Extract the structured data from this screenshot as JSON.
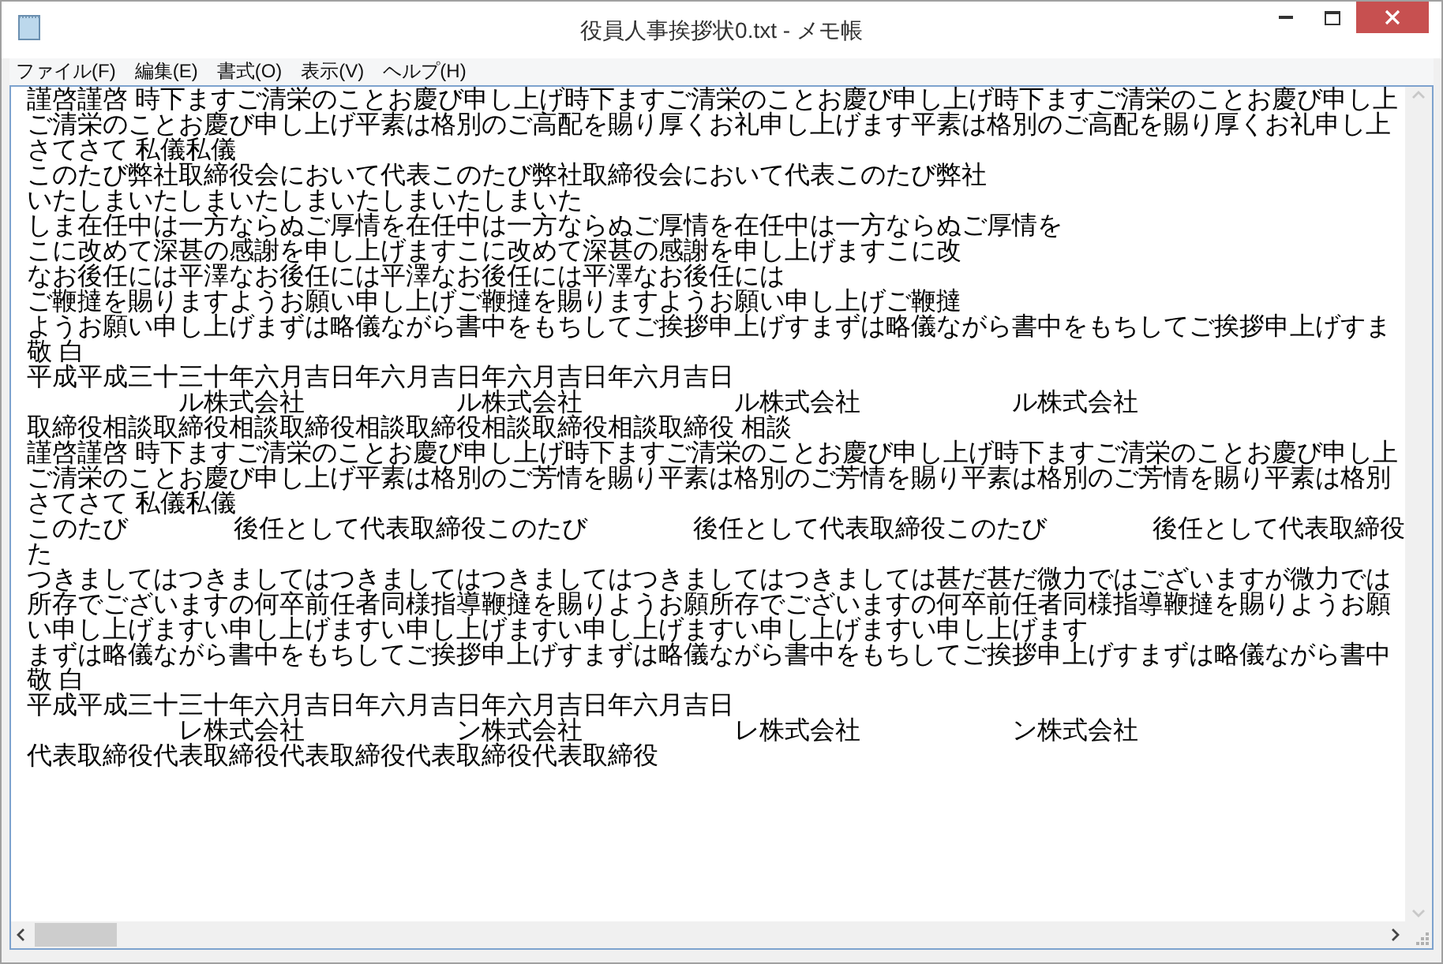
{
  "window": {
    "title": "役員人事挨拶状0.txt - メモ帳"
  },
  "menu": [
    "ファイル(F)",
    "編集(E)",
    "書式(O)",
    "表示(V)",
    "ヘルプ(H)"
  ],
  "lines": [
    {
      "segments": [
        {
          "kind": "text",
          "text": "謹啓謹啓 時下ますご清栄のことお慶び申し上げ時下ますご清栄のことお慶び申し上げ時下ますご清栄のことお慶び申し上"
        }
      ]
    },
    {
      "segments": [
        {
          "kind": "text",
          "text": "ご清栄のことお慶び申し上げ平素は格別のご高配を賜り厚くお礼申し上げます平素は格別のご高配を賜り厚くお礼申し上"
        }
      ]
    },
    {
      "segments": [
        {
          "kind": "text",
          "text": "さてさて 私儀私儀"
        }
      ]
    },
    {
      "segments": [
        {
          "kind": "text",
          "text": "このたび弊社取締役会において代表このたび弊社取締役会において代表このたび弊社"
        }
      ]
    },
    {
      "segments": [
        {
          "kind": "text",
          "text": "いたしまいたしまいたしまいたしまいたしまいた"
        }
      ]
    },
    {
      "segments": [
        {
          "kind": "text",
          "text": "しま在任中は一方ならぬご厚情を在任中は一方ならぬご厚情を在任中は一方ならぬご厚情を"
        }
      ]
    },
    {
      "segments": [
        {
          "kind": "text",
          "text": "こに改めて深甚の感謝を申し上げますこに改めて深甚の感謝を申し上げますこに改"
        }
      ]
    },
    {
      "segments": [
        {
          "kind": "text",
          "text": "なお後任には平澤なお後任には平澤なお後任には平澤なお後任には"
        }
      ]
    },
    {
      "segments": [
        {
          "kind": "text",
          "text": "ご鞭撻を賜りますようお願い申し上げご鞭撻を賜りますようお願い申し上げご鞭撻"
        }
      ]
    },
    {
      "segments": [
        {
          "kind": "text",
          "text": "ようお願い申し上げまずは略儀ながら書中をもちしてご挨拶申上げすまずは略儀ながら書中をもちしてご挨拶申上げすま"
        }
      ]
    },
    {
      "segments": [
        {
          "kind": "text",
          "text": "敬 白"
        }
      ]
    },
    {
      "segments": [
        {
          "kind": "text",
          "text": "平成平成三十三十年六月吉日年六月吉日年六月吉日年六月吉日"
        }
      ]
    },
    {
      "segments": [
        {
          "kind": "redacted"
        },
        {
          "kind": "text",
          "text": "ル株式会社"
        },
        {
          "kind": "redacted"
        },
        {
          "kind": "text",
          "text": "ル株式会社"
        },
        {
          "kind": "redacted"
        },
        {
          "kind": "text",
          "text": "ル株式会社"
        },
        {
          "kind": "redacted"
        },
        {
          "kind": "text",
          "text": "ル株式会社"
        }
      ]
    },
    {
      "segments": [
        {
          "kind": "text",
          "text": "取締役相談取締役相談取締役相談取締役相談取締役相談取締役 相談"
        },
        {
          "kind": "redacted"
        }
      ]
    },
    {
      "segments": [
        {
          "kind": "text",
          "text": "謹啓謹啓 時下ますご清栄のことお慶び申し上げ時下ますご清栄のことお慶び申し上げ時下ますご清栄のことお慶び申し上"
        }
      ]
    },
    {
      "segments": [
        {
          "kind": "text",
          "text": "ご清栄のことお慶び申し上げ平素は格別のご芳情を賜り平素は格別のご芳情を賜り平素は格別のご芳情を賜り平素は格別"
        }
      ]
    },
    {
      "segments": [
        {
          "kind": "text",
          "text": "さてさて 私儀私儀"
        }
      ]
    },
    {
      "segments": [
        {
          "kind": "text",
          "text": "このたび"
        },
        {
          "kind": "redacted"
        },
        {
          "kind": "text",
          "text": "後任として代表取締役このたび"
        },
        {
          "kind": "redacted"
        },
        {
          "kind": "text",
          "text": "後任として代表取締役このたび"
        },
        {
          "kind": "redacted"
        },
        {
          "kind": "text",
          "text": "後任として代表取締役"
        }
      ]
    },
    {
      "segments": [
        {
          "kind": "text",
          "text": "た"
        }
      ]
    },
    {
      "segments": [
        {
          "kind": "text",
          "text": "つきましてはつきましてはつきましてはつきましてはつきましてはつきましては甚だ甚だ微力ではございますが微力では"
        }
      ]
    },
    {
      "segments": [
        {
          "kind": "text",
          "text": "所存でございますの何卒前任者同様指導鞭撻を賜りようお願所存でございますの何卒前任者同様指導鞭撻を賜りようお願"
        }
      ]
    },
    {
      "segments": [
        {
          "kind": "text",
          "text": "い申し上げますい申し上げますい申し上げますい申し上げますい申し上げますい申し上げます"
        }
      ]
    },
    {
      "segments": [
        {
          "kind": "text",
          "text": "まずは略儀ながら書中をもちしてご挨拶申上げすまずは略儀ながら書中をもちしてご挨拶申上げすまずは略儀ながら書中"
        }
      ]
    },
    {
      "segments": [
        {
          "kind": "text",
          "text": "敬 白"
        }
      ]
    },
    {
      "segments": [
        {
          "kind": "text",
          "text": "平成平成三十三十年六月吉日年六月吉日年六月吉日年六月吉日"
        }
      ]
    },
    {
      "segments": [
        {
          "kind": "redacted"
        },
        {
          "kind": "text",
          "text": "レ株式会社"
        },
        {
          "kind": "redacted"
        },
        {
          "kind": "text",
          "text": "ン株式会社"
        },
        {
          "kind": "redacted"
        },
        {
          "kind": "text",
          "text": "レ株式会社"
        },
        {
          "kind": "redacted"
        },
        {
          "kind": "text",
          "text": "ン株式会社"
        }
      ]
    },
    {
      "segments": [
        {
          "kind": "text",
          "text": "代表取締役代表取締役代表取締役代表取締役代表取締役"
        },
        {
          "kind": "redacted"
        }
      ]
    }
  ]
}
